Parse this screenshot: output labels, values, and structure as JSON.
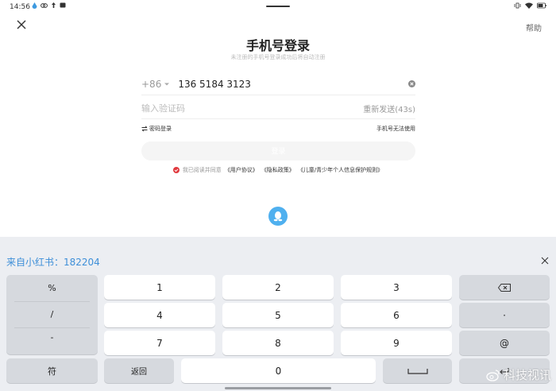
{
  "status_bar": {
    "time": "14:56",
    "left_icons": [
      "droplet-icon",
      "link-icon",
      "upload-icon",
      "message-icon"
    ],
    "right_icons": [
      "vibrate-icon",
      "wifi-icon",
      "battery-icon"
    ]
  },
  "header": {
    "title": "手机号登录",
    "subtitle": "未注册的手机号登录成功后将自动注册",
    "help": "帮助"
  },
  "form": {
    "country_code": "+86",
    "phone_value": "136 5184 3123",
    "code_placeholder": "输入验证码",
    "resend": "重新发送(43s)",
    "password_login": "密码登录",
    "phone_unavailable": "手机号无法使用",
    "login_button": "登录"
  },
  "agreement": {
    "prefix": "我已阅读并同意",
    "user_agreement": "《用户协议》",
    "privacy_policy": "《隐私政策》",
    "child_policy": "《儿童/青少年个人信息保护规则》"
  },
  "sms_suggestion": {
    "text": "来自小红书：182204"
  },
  "keyboard": {
    "side_symbols": [
      "%",
      "/",
      "-"
    ],
    "rows": [
      [
        "1",
        "2",
        "3"
      ],
      [
        "4",
        "5",
        "6"
      ],
      [
        "7",
        "8",
        "9"
      ]
    ],
    "right_column": [
      "·",
      "@"
    ],
    "symbol_key": "符",
    "back_key": "返回",
    "zero_key": "0"
  },
  "watermark": {
    "text": "科技视讯"
  },
  "colors": {
    "accent_blue": "#3e8fd8",
    "qq_blue": "#4fb0ef",
    "agree_red": "#e0393e",
    "keyboard_bg": "#eceef2"
  }
}
